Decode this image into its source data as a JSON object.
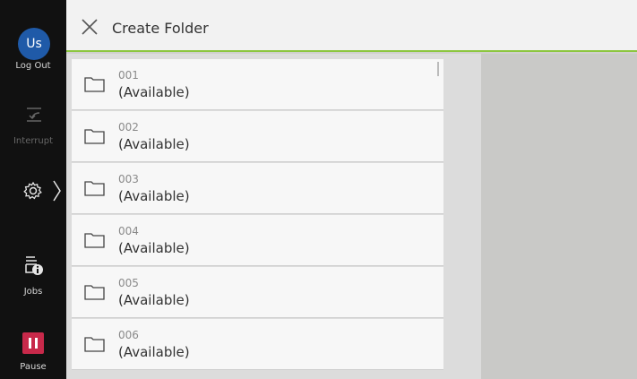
{
  "rail": {
    "avatar_text": "Us",
    "logout_label": "Log Out",
    "interrupt_label": "Interrupt",
    "jobs_label": "Jobs",
    "pause_label": "Pause"
  },
  "header": {
    "title": "Create Folder"
  },
  "folders": [
    {
      "number": "001",
      "status": "(Available)"
    },
    {
      "number": "002",
      "status": "(Available)"
    },
    {
      "number": "003",
      "status": "(Available)"
    },
    {
      "number": "004",
      "status": "(Available)"
    },
    {
      "number": "005",
      "status": "(Available)"
    },
    {
      "number": "006",
      "status": "(Available)"
    }
  ],
  "colors": {
    "accent_green": "#8cc63f",
    "avatar_blue": "#1f5aa8",
    "pause_red": "#c8294a"
  }
}
